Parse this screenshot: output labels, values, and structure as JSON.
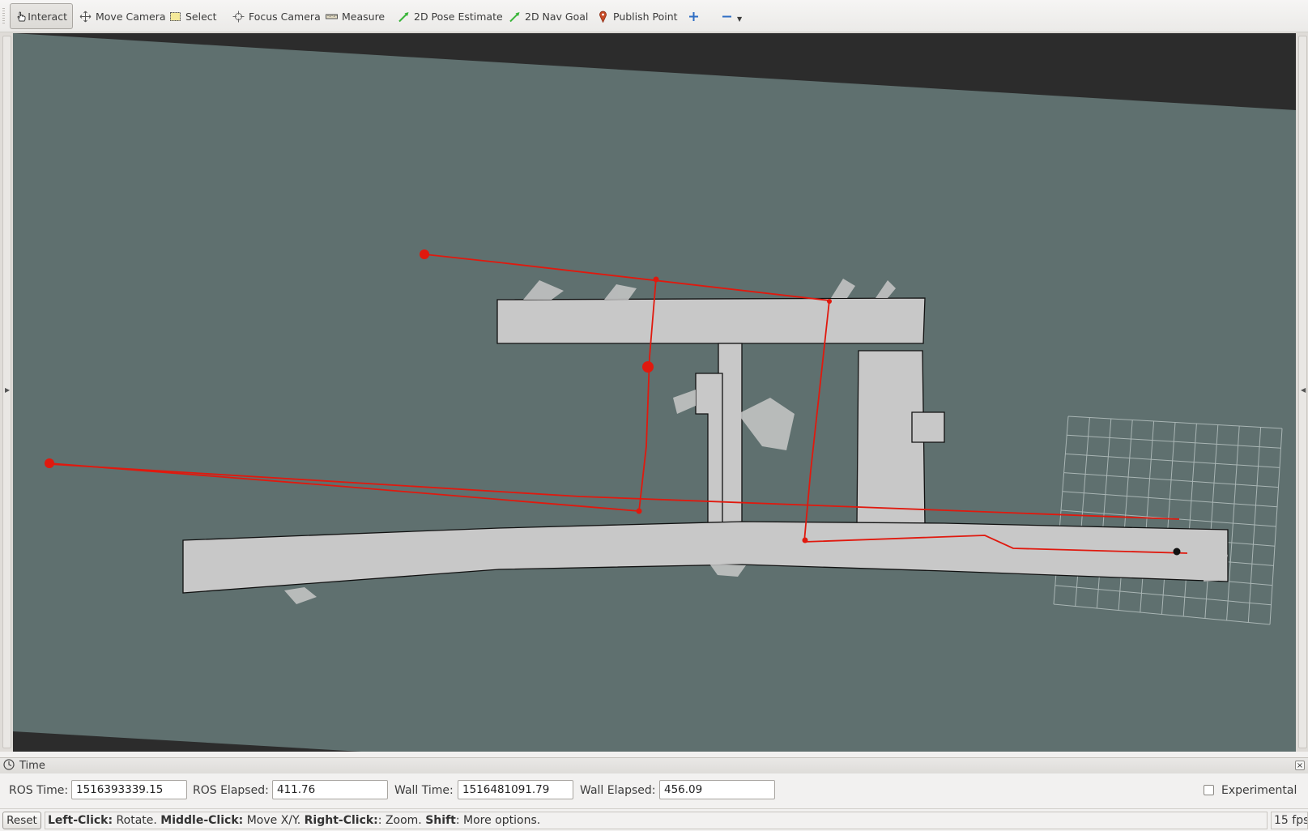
{
  "toolbar": {
    "tools": [
      {
        "label": "Interact",
        "icon": "hand-pointer-icon",
        "active": true
      },
      {
        "label": "Move Camera",
        "icon": "move-arrows-icon"
      },
      {
        "label": "Select",
        "icon": "select-box-icon"
      },
      {
        "label": "Focus Camera",
        "icon": "focus-crosshair-icon"
      },
      {
        "label": "Measure",
        "icon": "ruler-icon"
      },
      {
        "label": "2D Pose Estimate",
        "icon": "green-arrow-icon"
      },
      {
        "label": "2D Nav Goal",
        "icon": "green-arrow-icon"
      },
      {
        "label": "Publish Point",
        "icon": "map-pin-icon"
      }
    ],
    "add_tool_icon": "plus-icon",
    "remove_tool_icon": "minus-icon"
  },
  "viewport": {
    "background_color": "#5f706f",
    "map_free_color": "#c8c8c8",
    "path_color": "#e0190e",
    "grid_color": "#a9b5b4"
  },
  "time_panel": {
    "title": "Time",
    "ros_time_label": "ROS Time:",
    "ros_time_value": "1516393339.15",
    "ros_elapsed_label": "ROS Elapsed:",
    "ros_elapsed_value": "411.76",
    "wall_time_label": "Wall Time:",
    "wall_time_value": "1516481091.79",
    "wall_elapsed_label": "Wall Elapsed:",
    "wall_elapsed_value": "456.09",
    "experimental_label": "Experimental",
    "experimental_checked": false
  },
  "status_bar": {
    "reset_label": "Reset",
    "hint": {
      "left_click_key": "Left-Click:",
      "left_click_action": " Rotate. ",
      "middle_click_key": "Middle-Click:",
      "middle_click_action": " Move X/Y. ",
      "right_click_key": "Right-Click:",
      "right_click_action": ": Zoom. ",
      "shift_key": "Shift",
      "shift_action": ": More options."
    },
    "fps": "15 fps"
  }
}
